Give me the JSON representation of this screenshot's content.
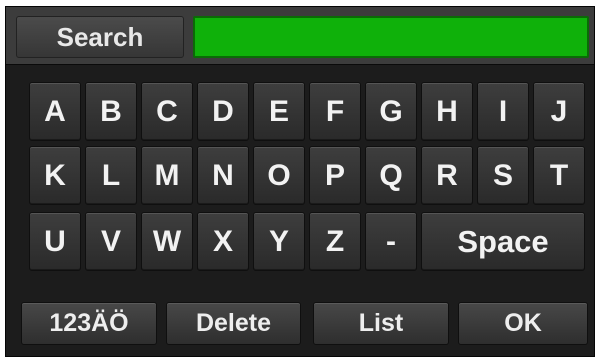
{
  "search": {
    "label": "Search",
    "value": "",
    "field_color": "#0fb10a"
  },
  "keyboard": {
    "rows": [
      [
        "A",
        "B",
        "C",
        "D",
        "E",
        "F",
        "G",
        "H",
        "I",
        "J"
      ],
      [
        "K",
        "L",
        "M",
        "N",
        "O",
        "P",
        "Q",
        "R",
        "S",
        "T"
      ],
      [
        "U",
        "V",
        "W",
        "X",
        "Y",
        "Z",
        "-"
      ]
    ],
    "space_label": "Space"
  },
  "function_keys": {
    "mode_label": "123ÄÖ",
    "delete_label": "Delete",
    "list_label": "List",
    "ok_label": "OK"
  }
}
